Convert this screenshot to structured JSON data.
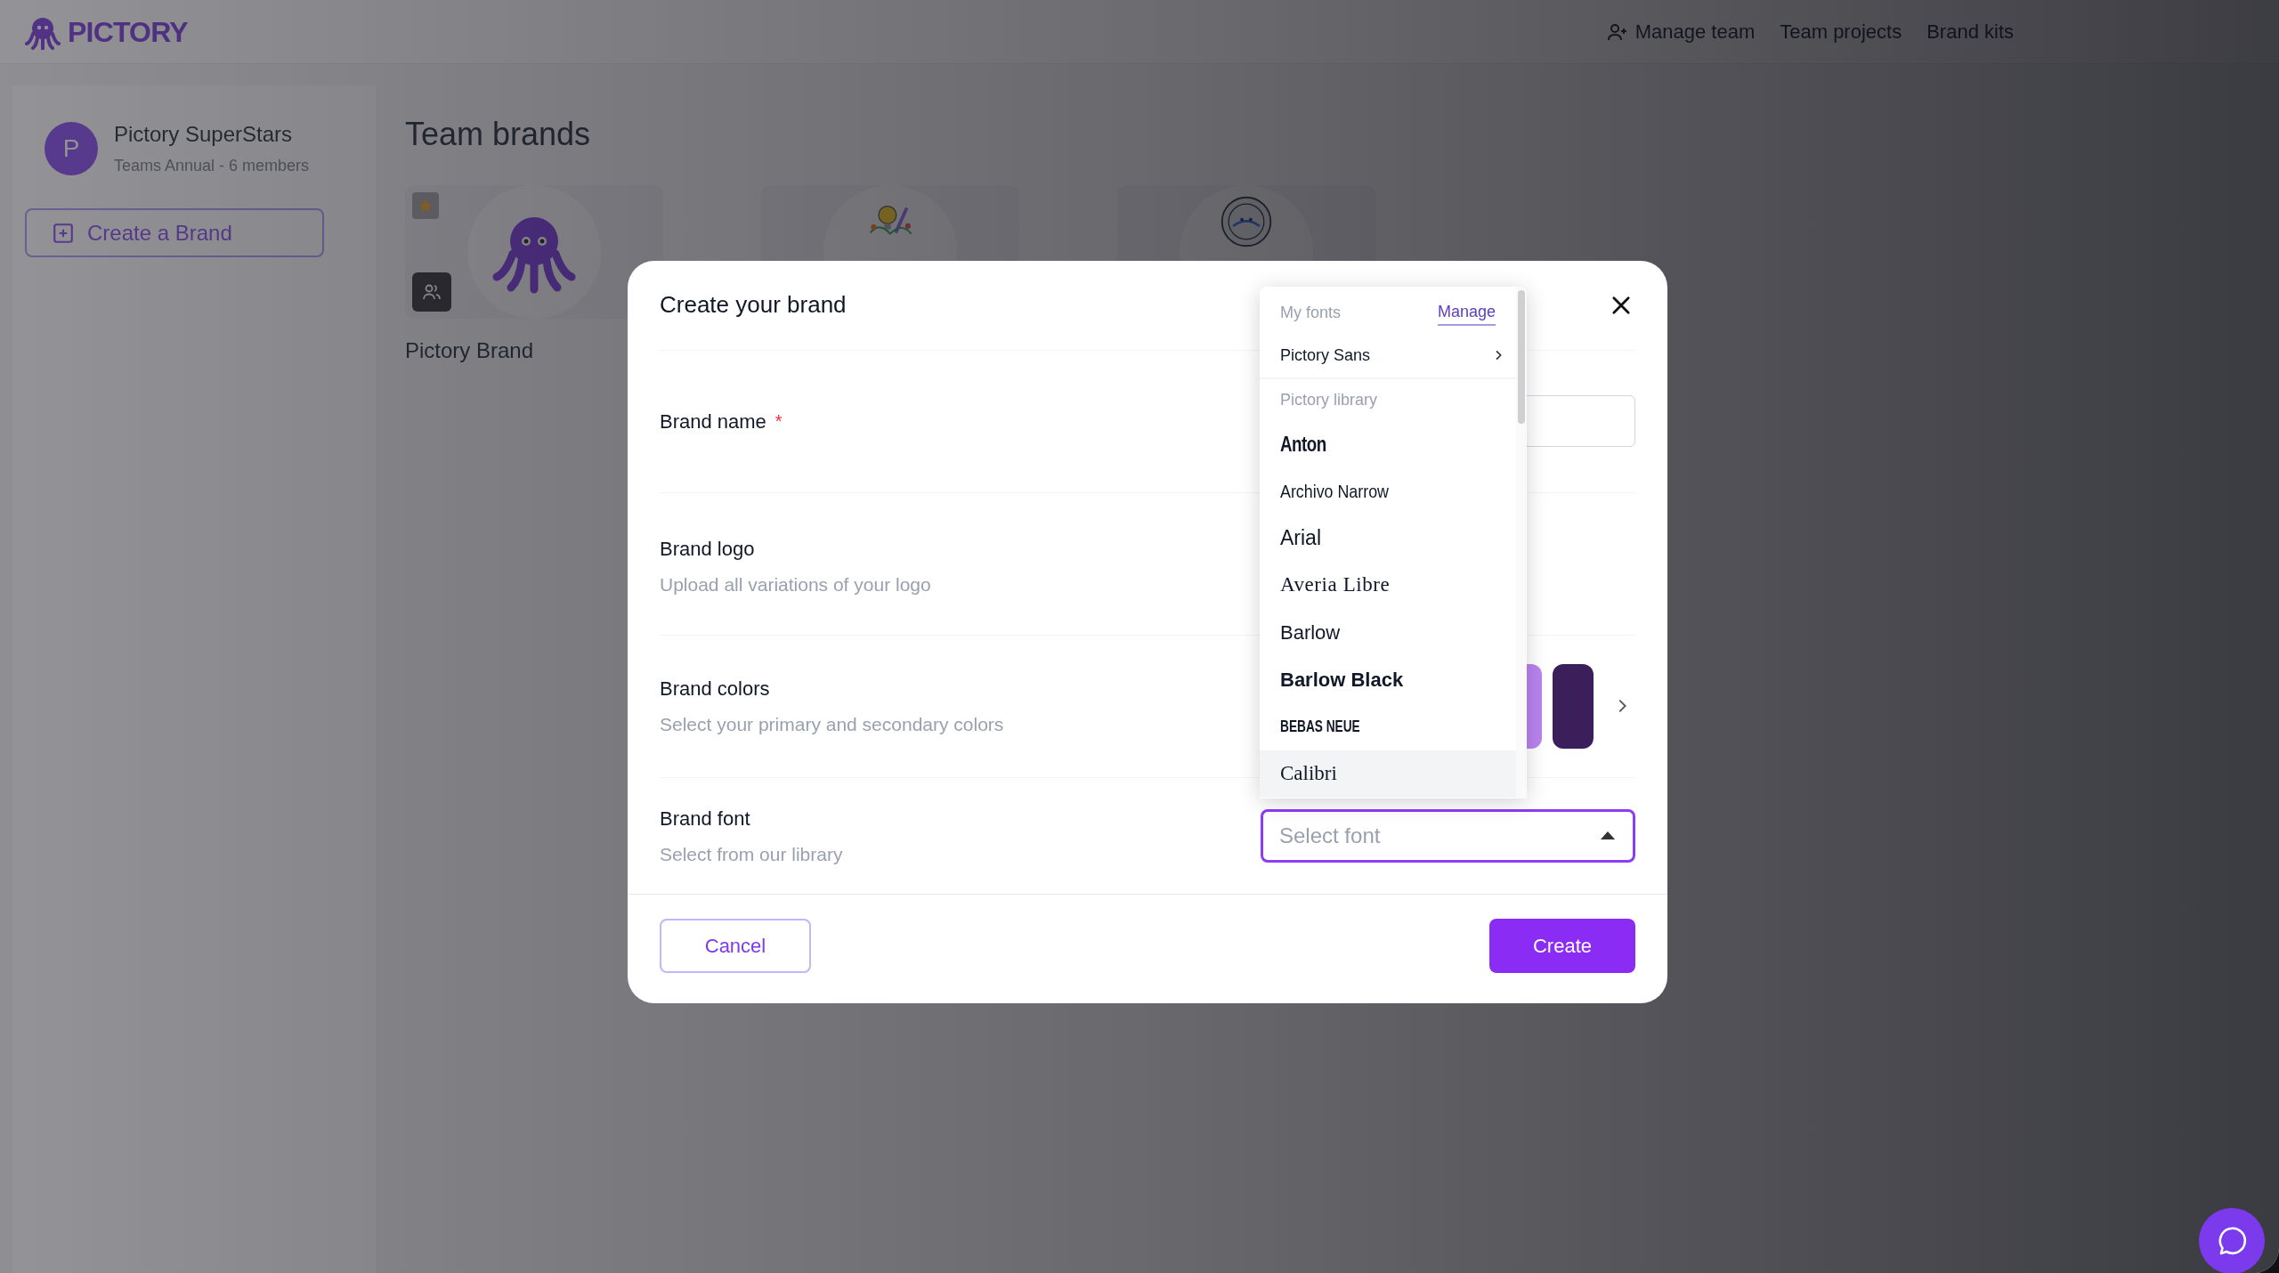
{
  "app": {
    "logo": "PICTORY"
  },
  "nav": [
    {
      "label": "Manage team",
      "kind": "with-icon"
    },
    {
      "label": "Team projects",
      "kind": "plain"
    },
    {
      "label": "Brand kits",
      "kind": "plain"
    }
  ],
  "team": {
    "avatar": "P",
    "name": "Pictory SuperStars",
    "plan": "Teams Annual - 6 members"
  },
  "sidebar": {
    "create_button": "Create a Brand"
  },
  "page": {
    "title": "Team brands",
    "brands": [
      {
        "name": "Pictory Brand",
        "kind": "octopus",
        "starred": true
      },
      {
        "kind": "lightbulb",
        "starred": false
      },
      {
        "kind": "emblem",
        "starred": false
      }
    ]
  },
  "modal": {
    "title": "Create your brand",
    "fields": [
      {
        "label": "Brand name",
        "kind": "text",
        "required_mark": "*"
      },
      {
        "label": "Brand logo",
        "hint": "Upload all variations of your logo",
        "kind": "upload"
      },
      {
        "label": "Brand colors",
        "hint": "Select your primary and secondary colors",
        "kind": "colors",
        "swatches": [
          {
            "color": "#b983ee"
          },
          {
            "color": "#3a1f5a"
          }
        ]
      },
      {
        "label": "Brand font",
        "hint": "Select from our library",
        "kind": "select",
        "placeholder": "Select font",
        "expanded": true
      }
    ],
    "cancel": "Cancel",
    "create": "Create"
  },
  "font_menu": {
    "my_fonts_heading": "My fonts",
    "manage_link": "Manage",
    "my_fonts": [
      {
        "name": "Pictory Sans"
      }
    ],
    "library_heading": "Pictory library",
    "library": [
      {
        "name": "Anton",
        "kind": "heavy",
        "highlighted": false
      },
      {
        "name": "Archivo Narrow",
        "kind": "narrow",
        "highlighted": false
      },
      {
        "name": "Arial",
        "kind": "regular",
        "highlighted": false
      },
      {
        "name": "Averia Libre",
        "kind": "serif",
        "highlighted": false
      },
      {
        "name": "Barlow",
        "kind": "light",
        "highlighted": false
      },
      {
        "name": "Barlow Black",
        "kind": "black",
        "highlighted": false
      },
      {
        "name": "BEBAS NEUE",
        "kind": "caps",
        "highlighted": false
      },
      {
        "name": "Calibri",
        "kind": "serif",
        "highlighted": true
      }
    ]
  }
}
